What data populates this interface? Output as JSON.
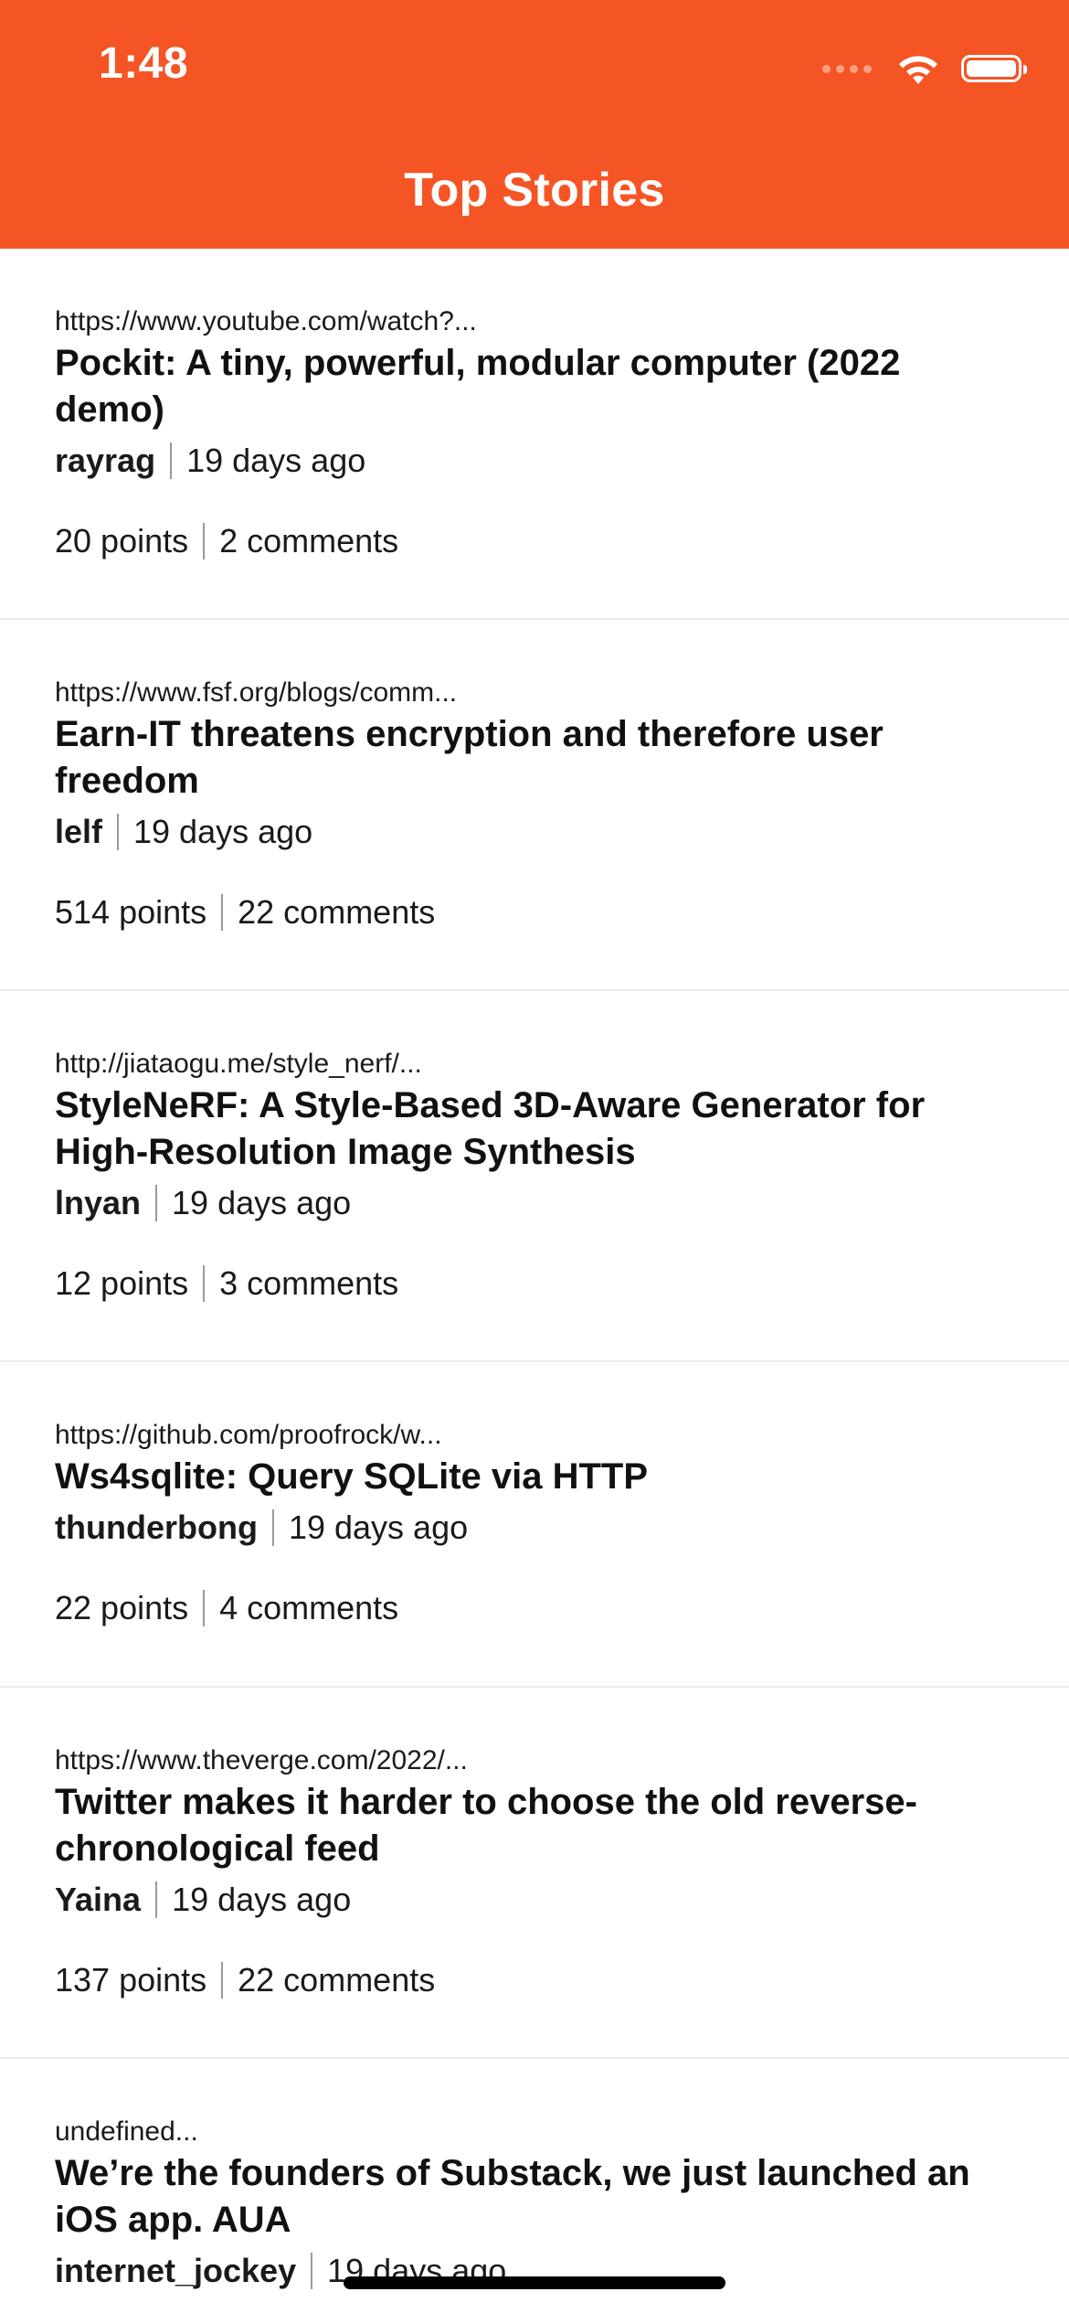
{
  "status_bar": {
    "time": "1:48"
  },
  "header": {
    "title": "Top Stories"
  },
  "colors": {
    "accent": "#F55425"
  },
  "stories": [
    {
      "url": "https://www.youtube.com/watch?...",
      "title": "Pockit: A tiny, powerful, modular computer (2022 demo)",
      "author": "rayrag",
      "age": "19 days ago",
      "points": "20 points",
      "comments": "2 comments"
    },
    {
      "url": "https://www.fsf.org/blogs/comm...",
      "title": "Earn-IT threatens encryption and therefore user freedom",
      "author": "lelf",
      "age": "19 days ago",
      "points": "514 points",
      "comments": "22 comments"
    },
    {
      "url": "http://jiataogu.me/style_nerf/...",
      "title": "StyleNeRF: A Style-Based 3D-Aware Generator for High-Resolution Image Synthesis",
      "author": "lnyan",
      "age": "19 days ago",
      "points": "12 points",
      "comments": "3 comments"
    },
    {
      "url": "https://github.com/proofrock/w...",
      "title": "Ws4sqlite: Query SQLite via HTTP",
      "author": "thunderbong",
      "age": "19 days ago",
      "points": "22 points",
      "comments": "4 comments"
    },
    {
      "url": "https://www.theverge.com/2022/...",
      "title": "Twitter makes it harder to choose the old reverse-chronological feed",
      "author": "Yaina",
      "age": "19 days ago",
      "points": "137 points",
      "comments": "22 comments"
    },
    {
      "url": "undefined...",
      "title": "We’re the founders of Substack, we just launched an iOS app. AUA",
      "author": "internet_jockey",
      "age": "19 days ago",
      "points": "",
      "comments": ""
    }
  ]
}
